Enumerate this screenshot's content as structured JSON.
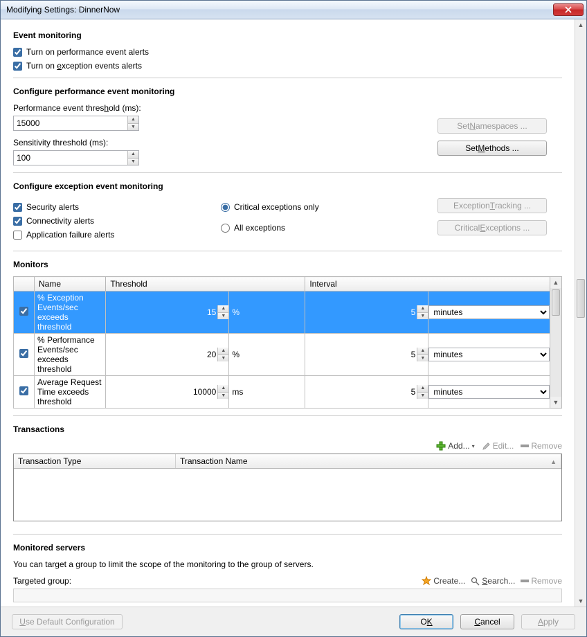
{
  "title": "Modifying Settings: DinnerNow",
  "eventMonitoring": {
    "heading": "Event monitoring",
    "perfAlerts": "Turn on performance event alerts",
    "excAlerts": "Turn on exception events alerts"
  },
  "perf": {
    "heading": "Configure performance event monitoring",
    "thresholdLabelPre": "Performance event thres",
    "thresholdLabelU": "h",
    "thresholdLabelPost": "old (ms):",
    "thresholdValue": "15000",
    "sensitivityLabel": "Sensitivity threshold (ms):",
    "sensitivityValue": "100",
    "setNamespacesPre": "Set ",
    "setNamespacesU": "N",
    "setNamespacesPost": "amespaces ...",
    "setMethodsPre": "Set ",
    "setMethodsU": "M",
    "setMethodsPost": "ethods ..."
  },
  "exc": {
    "heading": "Configure exception event monitoring",
    "security": "Security alerts",
    "connectivity": "Connectivity alerts",
    "appFailure": "Application failure alerts",
    "criticalOnly": "Critical exceptions only",
    "allExceptions": "All exceptions",
    "trackingPre": "Exception ",
    "trackingU": "T",
    "trackingPost": "racking ...",
    "criticalBtnPre": "Critical ",
    "criticalBtnU": "E",
    "criticalBtnPost": "xceptions ..."
  },
  "monitors": {
    "heading": "Monitors",
    "cols": {
      "name": "Name",
      "threshold": "Threshold",
      "interval": "Interval"
    },
    "rows": [
      {
        "name": "% Exception Events/sec exceeds threshold",
        "threshold": "15",
        "unit": "%",
        "interval": "5",
        "intervalUnit": "minutes",
        "checked": true
      },
      {
        "name": "% Performance Events/sec exceeds threshold",
        "threshold": "20",
        "unit": "%",
        "interval": "5",
        "intervalUnit": "minutes",
        "checked": true
      },
      {
        "name": "Average Request Time exceeds threshold",
        "threshold": "10000",
        "unit": "ms",
        "interval": "5",
        "intervalUnit": "minutes",
        "checked": true
      }
    ]
  },
  "transactions": {
    "heading": "Transactions",
    "add": "Add...",
    "edit": "Edit...",
    "remove": "Remove",
    "cols": {
      "type": "Transaction Type",
      "name": "Transaction Name"
    }
  },
  "servers": {
    "heading": "Monitored servers",
    "desc": "You can target a group to limit the scope of the monitoring to the group of servers.",
    "targetLabel": "Targeted group:",
    "create": "Create...",
    "searchPre": "",
    "searchU": "S",
    "searchPost": "earch...",
    "remove": "Remove"
  },
  "footer": {
    "useDefault": "Use Default Configuration",
    "okPre": "O",
    "okU": "K",
    "cancelU": "C",
    "cancelPost": "ancel",
    "applyU": "A",
    "applyPost": "pply"
  }
}
